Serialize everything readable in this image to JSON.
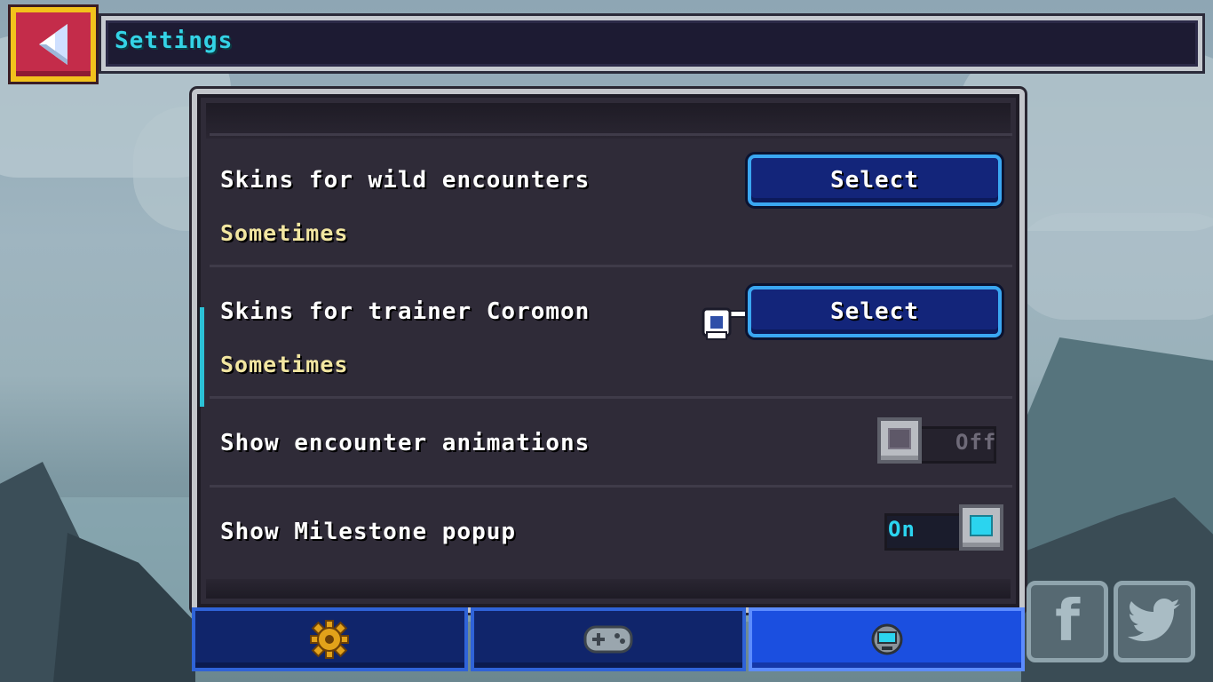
{
  "header": {
    "back_icon": "triangle-left-icon",
    "title": "Settings"
  },
  "settings": [
    {
      "label": "Skins for wild encounters",
      "value": "Sometimes",
      "button_label": "Select"
    },
    {
      "label": "Skins for trainer Coromon",
      "value": "Sometimes",
      "button_label": "Select"
    },
    {
      "label": "Show encounter animations",
      "toggle_text": "Off",
      "enabled": false
    },
    {
      "label": "Show Milestone popup",
      "toggle_text": "On",
      "enabled": true
    }
  ],
  "tabs": [
    {
      "icon": "gear-icon",
      "active": false
    },
    {
      "icon": "gamepad-icon",
      "active": false
    },
    {
      "icon": "monitor-icon",
      "active": true
    }
  ],
  "social": [
    {
      "icon": "facebook-icon",
      "glyph": "f"
    },
    {
      "icon": "twitter-icon",
      "glyph": "🐦"
    }
  ],
  "colors": {
    "title_cyan": "#34d3e6",
    "value_yellow": "#f2e6a1",
    "button_blue": "#13257a",
    "back_red": "#c42c4a",
    "toggle_on_cyan": "#2bd4ef"
  }
}
